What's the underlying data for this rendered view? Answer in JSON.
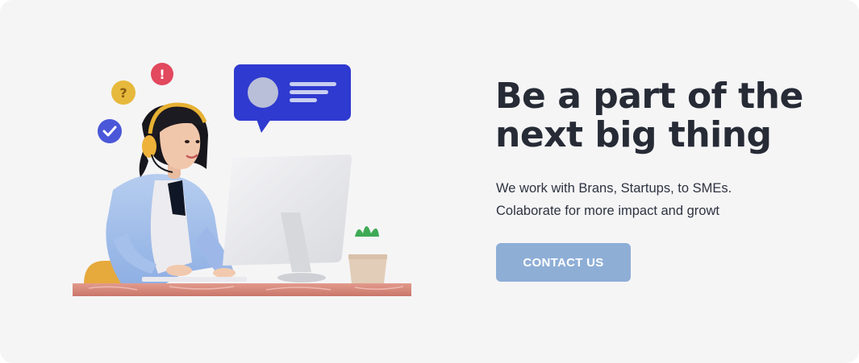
{
  "headline": {
    "line1": "Be a part of the",
    "line2": "next big thing"
  },
  "subtext": {
    "line1": "We work with Brans, Startups, to SMEs.",
    "line2": "Colaborate for more impact and growt"
  },
  "cta": {
    "label": "CONTACT US"
  },
  "illustration": {
    "badge_question": "?",
    "badge_alert": "!",
    "icons": [
      "check-badge-icon",
      "question-badge-icon",
      "alert-badge-icon",
      "chat-bubble-icon",
      "headset-icon",
      "monitor-icon",
      "plant-icon"
    ]
  },
  "colors": {
    "background": "#f5f5f6",
    "heading": "#262b36",
    "text": "#2d3340",
    "button": "#8eaed6",
    "chat_bubble": "#2f3ad0",
    "badge_blue": "#4a57d8",
    "badge_yellow": "#e6b93c",
    "badge_red": "#e2485e",
    "desk": "#d9877a"
  }
}
